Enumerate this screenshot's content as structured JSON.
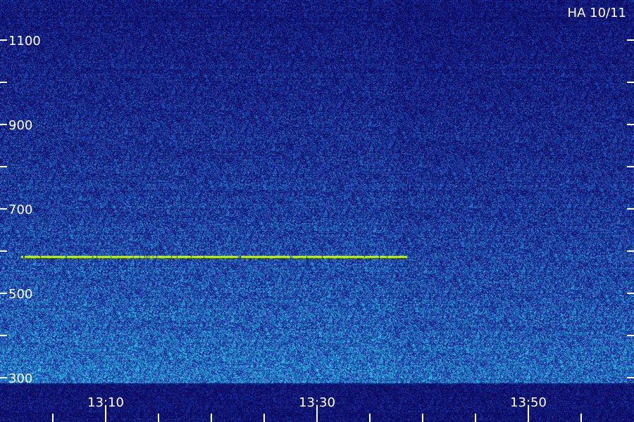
{
  "chart_data": {
    "type": "heatmap",
    "title": "HA 10/11",
    "xlabel": "",
    "ylabel": "",
    "y_ticks": [
      300,
      500,
      700,
      900,
      1100
    ],
    "y_minor_ticks": [
      400,
      600,
      800,
      1000,
      1200
    ],
    "ylim": [
      300,
      1203
    ],
    "x_ticks": [
      "13:10",
      "13:30",
      "13:50"
    ],
    "x_tick_minutes": [
      10,
      30,
      50
    ],
    "x_minor_tick_minutes": [
      5,
      15,
      20,
      25,
      35,
      40,
      45,
      55
    ],
    "xlim_minutes": [
      2,
      62
    ],
    "series": [
      {
        "value": 587,
        "x_start_minutes": 2,
        "x_end_minutes": 38.5,
        "color": "#ccff00"
      }
    ],
    "colors": {
      "background_low": "#0b0b6e",
      "background_high": "#1fa0e0",
      "signal": "#ccff00"
    }
  }
}
